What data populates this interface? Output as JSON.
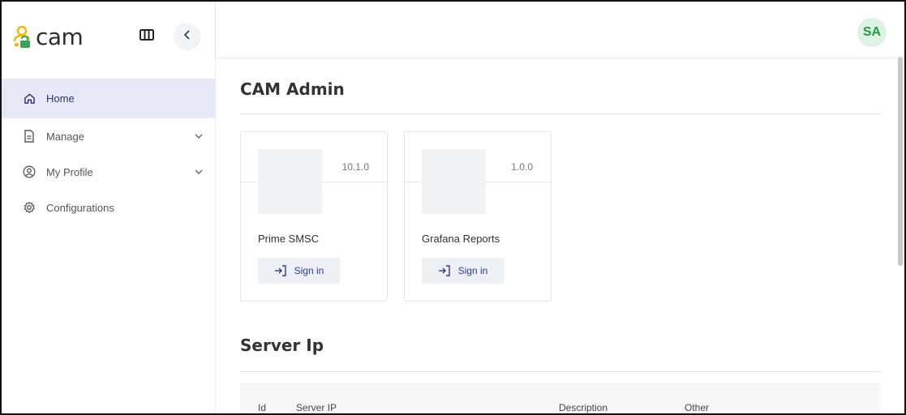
{
  "brand": {
    "name": "cam",
    "logo_icon": "user-lock-icon",
    "accent": "#f5b800",
    "secondary": "#3aa35b"
  },
  "sidebar": {
    "columns_icon": "columns-icon",
    "collapse_icon": "chevron-left-icon",
    "items": [
      {
        "label": "Home",
        "icon": "home-icon",
        "active": true
      },
      {
        "label": "Manage",
        "icon": "document-icon",
        "expandable": true
      },
      {
        "label": "My Profile",
        "icon": "user-circle-icon",
        "expandable": true
      },
      {
        "label": "Configurations",
        "icon": "gear-icon"
      }
    ]
  },
  "header": {
    "avatar_initials": "SA",
    "avatar_color": "#1f9d46"
  },
  "main": {
    "admin_title": "CAM Admin",
    "apps": [
      {
        "name": "Prime SMSC",
        "version": "10.1.0",
        "action": "Sign in",
        "action_icon": "sign-in-icon"
      },
      {
        "name": "Grafana Reports",
        "version": "1.0.0",
        "action": "Sign in",
        "action_icon": "sign-in-icon"
      }
    ],
    "server_title": "Server Ip",
    "table": {
      "columns": [
        "Id",
        "Server IP",
        "Description",
        "Other"
      ]
    }
  }
}
